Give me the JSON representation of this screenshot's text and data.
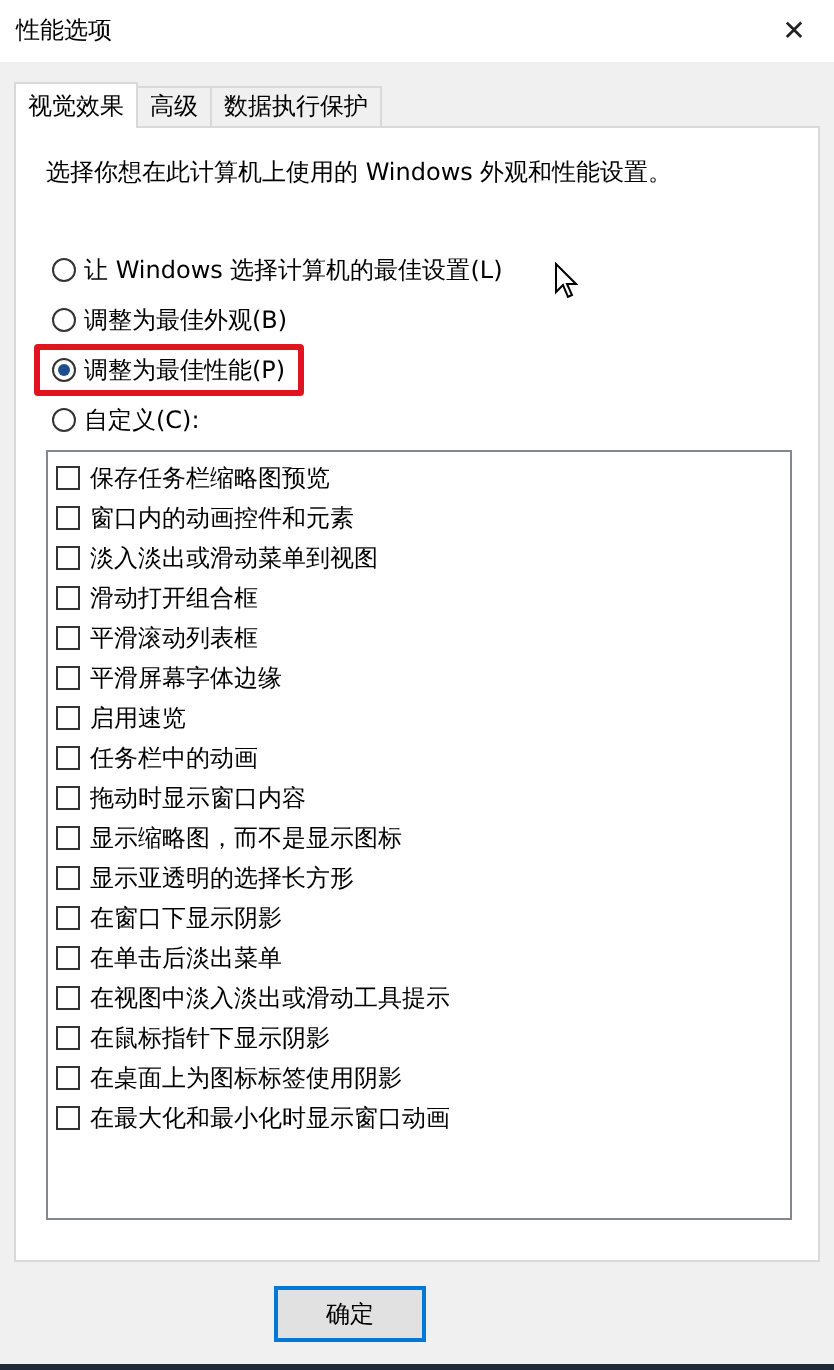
{
  "window": {
    "title": "性能选项",
    "close": "✕"
  },
  "tabs": [
    {
      "label": "视觉效果",
      "selected": true
    },
    {
      "label": "高级",
      "selected": false
    },
    {
      "label": "数据执行保护",
      "selected": false
    }
  ],
  "description": "选择你想在此计算机上使用的 Windows 外观和性能设置。",
  "options": [
    {
      "label": "让 Windows 选择计算机的最佳设置(L)",
      "selected": false,
      "highlighted": false
    },
    {
      "label": "调整为最佳外观(B)",
      "selected": false,
      "highlighted": false
    },
    {
      "label": "调整为最佳性能(P)",
      "selected": true,
      "highlighted": true
    },
    {
      "label": "自定义(C):",
      "selected": false,
      "highlighted": false
    }
  ],
  "effects": [
    {
      "label": "保存任务栏缩略图预览",
      "checked": false
    },
    {
      "label": "窗口内的动画控件和元素",
      "checked": false
    },
    {
      "label": "淡入淡出或滑动菜单到视图",
      "checked": false
    },
    {
      "label": "滑动打开组合框",
      "checked": false
    },
    {
      "label": "平滑滚动列表框",
      "checked": false
    },
    {
      "label": "平滑屏幕字体边缘",
      "checked": false
    },
    {
      "label": "启用速览",
      "checked": false
    },
    {
      "label": "任务栏中的动画",
      "checked": false
    },
    {
      "label": "拖动时显示窗口内容",
      "checked": false
    },
    {
      "label": "显示缩略图，而不是显示图标",
      "checked": false
    },
    {
      "label": "显示亚透明的选择长方形",
      "checked": false
    },
    {
      "label": "在窗口下显示阴影",
      "checked": false
    },
    {
      "label": "在单击后淡出菜单",
      "checked": false
    },
    {
      "label": "在视图中淡入淡出或滑动工具提示",
      "checked": false
    },
    {
      "label": "在鼠标指针下显示阴影",
      "checked": false
    },
    {
      "label": "在桌面上为图标标签使用阴影",
      "checked": false
    },
    {
      "label": "在最大化和最小化时显示窗口动画",
      "checked": false
    }
  ],
  "buttons": [
    "确定"
  ]
}
